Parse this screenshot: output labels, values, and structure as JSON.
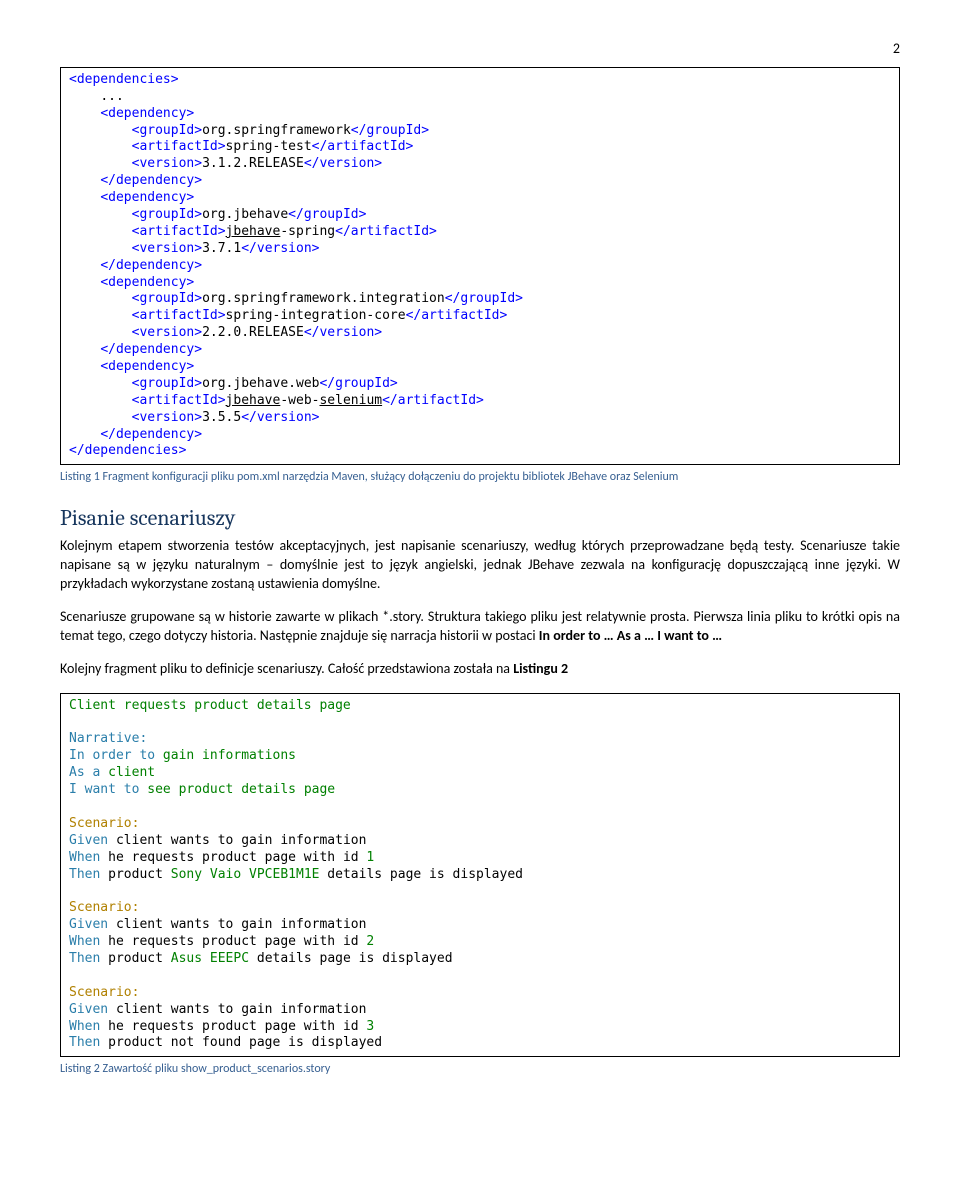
{
  "pageNumber": "2",
  "code1": {
    "l1": "<dependencies>",
    "l2": "    ...",
    "l3": "    <dependency>",
    "l4a": "        <groupId>",
    "l4b": "org.springframework",
    "l4c": "</groupId>",
    "l5a": "        <artifactId>",
    "l5b": "spring-test",
    "l5c": "</artifactId>",
    "l6a": "        <version>",
    "l6b": "3.1.2.RELEASE",
    "l6c": "</version>",
    "l7": "    </dependency>",
    "l8": "    <dependency>",
    "l9a": "        <groupId>",
    "l9b": "org.jbehave",
    "l9c": "</groupId>",
    "l10a": "        <artifactId>",
    "l10b1": "jbehave",
    "l10b2": "-spring",
    "l10c": "</artifactId>",
    "l11a": "        <version>",
    "l11b": "3.7.1",
    "l11c": "</version>",
    "l12": "    </dependency>",
    "l13": "    <dependency>",
    "l14a": "        <groupId>",
    "l14b": "org.springframework.integration",
    "l14c": "</groupId>",
    "l15a": "        <artifactId>",
    "l15b": "spring-integration-core",
    "l15c": "</artifactId>",
    "l16a": "        <version>",
    "l16b": "2.2.0.RELEASE",
    "l16c": "</version>",
    "l17": "    </dependency>",
    "l18": "    <dependency>",
    "l19a": "        <groupId>",
    "l19b": "org.jbehave.web",
    "l19c": "</groupId>",
    "l20a": "        <artifactId>",
    "l20b1": "jbehave",
    "l20b2": "-web-",
    "l20b3": "selenium",
    "l20c": "</artifactId>",
    "l21a": "        <version>",
    "l21b": "3.5.5",
    "l21c": "</version>",
    "l22": "    </dependency>",
    "l23": "</dependencies>"
  },
  "caption1": "Listing 1 Fragment konfiguracji pliku pom.xml narzędzia Maven, służący dołączeniu do projektu bibliotek JBehave oraz Selenium",
  "h2": "Pisanie scenariuszy",
  "p1": "Kolejnym etapem stworzenia testów akceptacyjnych, jest napisanie scenariuszy, według których przeprowadzane będą testy. Scenariusze takie napisane są w języku naturalnym – domyślnie jest to język angielski, jednak JBehave zezwala na konfigurację dopuszczającą inne języki. W przykładach wykorzystane zostaną ustawienia domyślne.",
  "p2a": "Scenariusze grupowane są w historie zawarte w plikach *.story. Struktura takiego pliku jest relatywnie prosta. Pierwsza linia pliku to krótki opis na temat tego, czego dotyczy historia. Następnie znajduje się narracja historii w postaci ",
  "p2b": "In order to … As a … I want to …",
  "p3a": "Kolejny fragment pliku to definicje scenariuszy. Całość przedstawiona została na ",
  "p3b": "Listingu 2",
  "code2": {
    "title": "Client requests product details page",
    "narrLabel": "Narrative:",
    "inOrder": "In order to ",
    "inOrderVal": "gain informations",
    "asA": "As a ",
    "asAVal": "client",
    "want": "I want to ",
    "wantVal": "see product details page",
    "scenLabel": "Scenario:",
    "given": "Given ",
    "givenVal": "client wants to gain information",
    "when": "When ",
    "whenA": "he requests product page with id ",
    "id1": "1",
    "id2": "2",
    "id3": "3",
    "then": "Then ",
    "thenA": "product ",
    "prod1": "Sony Vaio VPCEB1M1E",
    "prod2": "Asus EEEPC",
    "thenB": " details page is displayed",
    "then3": "product not found page is displayed"
  },
  "caption2": "Listing 2 Zawartość pliku show_product_scenarios.story"
}
